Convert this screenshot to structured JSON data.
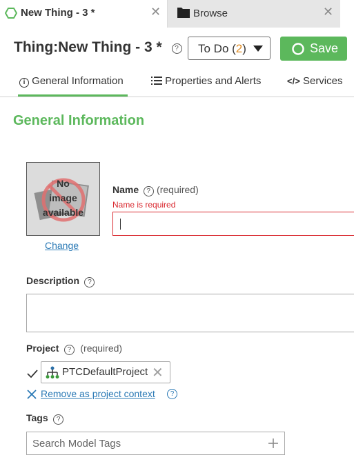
{
  "tabs": [
    {
      "label": "New Thing - 3 *",
      "active": true,
      "icon": "hexagon-icon"
    },
    {
      "label": "Browse",
      "active": false,
      "icon": "folder-icon"
    }
  ],
  "header": {
    "title": "Thing:New Thing - 3 *",
    "todo_label": "To Do (",
    "todo_count": "2",
    "todo_close": ")",
    "save_label": "Save"
  },
  "subtabs": [
    {
      "label": "General Information",
      "icon": "info-icon",
      "active": true
    },
    {
      "label": "Properties and Alerts",
      "icon": "list-icon"
    },
    {
      "label": "Services",
      "icon": "code-icon"
    }
  ],
  "section_title": "General Information",
  "image": {
    "placeholder_line1": "No",
    "placeholder_line2": "image",
    "placeholder_line3": "available",
    "change_label": "Change"
  },
  "name": {
    "label": "Name",
    "required": "(required)",
    "error": "Name is required",
    "value": ""
  },
  "description": {
    "label": "Description",
    "value": ""
  },
  "project": {
    "label": "Project",
    "required": "(required)",
    "value": "PTCDefaultProject",
    "remove_label": "Remove as project context"
  },
  "tags": {
    "label": "Tags",
    "placeholder": "Search Model Tags"
  },
  "colors": {
    "accent": "#5cb85c",
    "error": "#d9272e",
    "link": "#2a79b5",
    "count": "#e08a1f"
  }
}
